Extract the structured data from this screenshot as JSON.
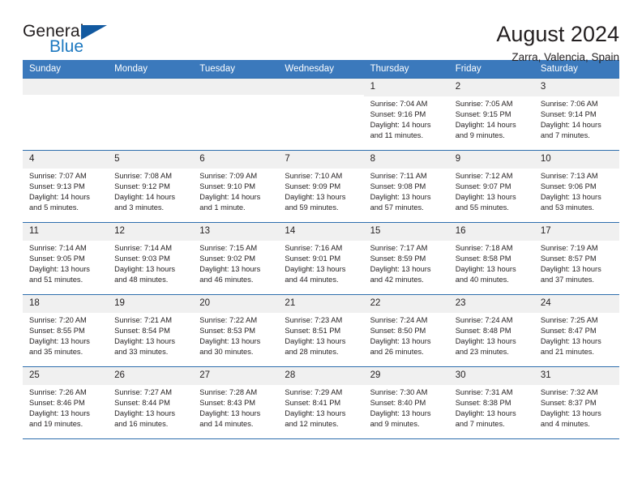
{
  "brand": {
    "word_one": "General",
    "word_two": "Blue",
    "triangle_color": "#1259a0",
    "blue_color": "#1c78c0"
  },
  "header": {
    "title": "August 2024",
    "subtitle": "Zarra, Valencia, Spain",
    "accent_color": "#3b79bc",
    "border_color": "#2e6ead",
    "daynum_band_color": "#f0f0f0"
  },
  "weekdays": [
    "Sunday",
    "Monday",
    "Tuesday",
    "Wednesday",
    "Thursday",
    "Friday",
    "Saturday"
  ],
  "labels": {
    "sunrise": "Sunrise:",
    "sunset": "Sunset:",
    "daylight": "Daylight:"
  },
  "weeks": [
    [
      {
        "day": "",
        "empty": true
      },
      {
        "day": "",
        "empty": true
      },
      {
        "day": "",
        "empty": true
      },
      {
        "day": "",
        "empty": true
      },
      {
        "day": "1",
        "sunrise": "Sunrise: 7:04 AM",
        "sunset": "Sunset: 9:16 PM",
        "daylight": "Daylight: 14 hours and 11 minutes."
      },
      {
        "day": "2",
        "sunrise": "Sunrise: 7:05 AM",
        "sunset": "Sunset: 9:15 PM",
        "daylight": "Daylight: 14 hours and 9 minutes."
      },
      {
        "day": "3",
        "sunrise": "Sunrise: 7:06 AM",
        "sunset": "Sunset: 9:14 PM",
        "daylight": "Daylight: 14 hours and 7 minutes."
      }
    ],
    [
      {
        "day": "4",
        "sunrise": "Sunrise: 7:07 AM",
        "sunset": "Sunset: 9:13 PM",
        "daylight": "Daylight: 14 hours and 5 minutes."
      },
      {
        "day": "5",
        "sunrise": "Sunrise: 7:08 AM",
        "sunset": "Sunset: 9:12 PM",
        "daylight": "Daylight: 14 hours and 3 minutes."
      },
      {
        "day": "6",
        "sunrise": "Sunrise: 7:09 AM",
        "sunset": "Sunset: 9:10 PM",
        "daylight": "Daylight: 14 hours and 1 minute."
      },
      {
        "day": "7",
        "sunrise": "Sunrise: 7:10 AM",
        "sunset": "Sunset: 9:09 PM",
        "daylight": "Daylight: 13 hours and 59 minutes."
      },
      {
        "day": "8",
        "sunrise": "Sunrise: 7:11 AM",
        "sunset": "Sunset: 9:08 PM",
        "daylight": "Daylight: 13 hours and 57 minutes."
      },
      {
        "day": "9",
        "sunrise": "Sunrise: 7:12 AM",
        "sunset": "Sunset: 9:07 PM",
        "daylight": "Daylight: 13 hours and 55 minutes."
      },
      {
        "day": "10",
        "sunrise": "Sunrise: 7:13 AM",
        "sunset": "Sunset: 9:06 PM",
        "daylight": "Daylight: 13 hours and 53 minutes."
      }
    ],
    [
      {
        "day": "11",
        "sunrise": "Sunrise: 7:14 AM",
        "sunset": "Sunset: 9:05 PM",
        "daylight": "Daylight: 13 hours and 51 minutes."
      },
      {
        "day": "12",
        "sunrise": "Sunrise: 7:14 AM",
        "sunset": "Sunset: 9:03 PM",
        "daylight": "Daylight: 13 hours and 48 minutes."
      },
      {
        "day": "13",
        "sunrise": "Sunrise: 7:15 AM",
        "sunset": "Sunset: 9:02 PM",
        "daylight": "Daylight: 13 hours and 46 minutes."
      },
      {
        "day": "14",
        "sunrise": "Sunrise: 7:16 AM",
        "sunset": "Sunset: 9:01 PM",
        "daylight": "Daylight: 13 hours and 44 minutes."
      },
      {
        "day": "15",
        "sunrise": "Sunrise: 7:17 AM",
        "sunset": "Sunset: 8:59 PM",
        "daylight": "Daylight: 13 hours and 42 minutes."
      },
      {
        "day": "16",
        "sunrise": "Sunrise: 7:18 AM",
        "sunset": "Sunset: 8:58 PM",
        "daylight": "Daylight: 13 hours and 40 minutes."
      },
      {
        "day": "17",
        "sunrise": "Sunrise: 7:19 AM",
        "sunset": "Sunset: 8:57 PM",
        "daylight": "Daylight: 13 hours and 37 minutes."
      }
    ],
    [
      {
        "day": "18",
        "sunrise": "Sunrise: 7:20 AM",
        "sunset": "Sunset: 8:55 PM",
        "daylight": "Daylight: 13 hours and 35 minutes."
      },
      {
        "day": "19",
        "sunrise": "Sunrise: 7:21 AM",
        "sunset": "Sunset: 8:54 PM",
        "daylight": "Daylight: 13 hours and 33 minutes."
      },
      {
        "day": "20",
        "sunrise": "Sunrise: 7:22 AM",
        "sunset": "Sunset: 8:53 PM",
        "daylight": "Daylight: 13 hours and 30 minutes."
      },
      {
        "day": "21",
        "sunrise": "Sunrise: 7:23 AM",
        "sunset": "Sunset: 8:51 PM",
        "daylight": "Daylight: 13 hours and 28 minutes."
      },
      {
        "day": "22",
        "sunrise": "Sunrise: 7:24 AM",
        "sunset": "Sunset: 8:50 PM",
        "daylight": "Daylight: 13 hours and 26 minutes."
      },
      {
        "day": "23",
        "sunrise": "Sunrise: 7:24 AM",
        "sunset": "Sunset: 8:48 PM",
        "daylight": "Daylight: 13 hours and 23 minutes."
      },
      {
        "day": "24",
        "sunrise": "Sunrise: 7:25 AM",
        "sunset": "Sunset: 8:47 PM",
        "daylight": "Daylight: 13 hours and 21 minutes."
      }
    ],
    [
      {
        "day": "25",
        "sunrise": "Sunrise: 7:26 AM",
        "sunset": "Sunset: 8:46 PM",
        "daylight": "Daylight: 13 hours and 19 minutes."
      },
      {
        "day": "26",
        "sunrise": "Sunrise: 7:27 AM",
        "sunset": "Sunset: 8:44 PM",
        "daylight": "Daylight: 13 hours and 16 minutes."
      },
      {
        "day": "27",
        "sunrise": "Sunrise: 7:28 AM",
        "sunset": "Sunset: 8:43 PM",
        "daylight": "Daylight: 13 hours and 14 minutes."
      },
      {
        "day": "28",
        "sunrise": "Sunrise: 7:29 AM",
        "sunset": "Sunset: 8:41 PM",
        "daylight": "Daylight: 13 hours and 12 minutes."
      },
      {
        "day": "29",
        "sunrise": "Sunrise: 7:30 AM",
        "sunset": "Sunset: 8:40 PM",
        "daylight": "Daylight: 13 hours and 9 minutes."
      },
      {
        "day": "30",
        "sunrise": "Sunrise: 7:31 AM",
        "sunset": "Sunset: 8:38 PM",
        "daylight": "Daylight: 13 hours and 7 minutes."
      },
      {
        "day": "31",
        "sunrise": "Sunrise: 7:32 AM",
        "sunset": "Sunset: 8:37 PM",
        "daylight": "Daylight: 13 hours and 4 minutes."
      }
    ]
  ]
}
